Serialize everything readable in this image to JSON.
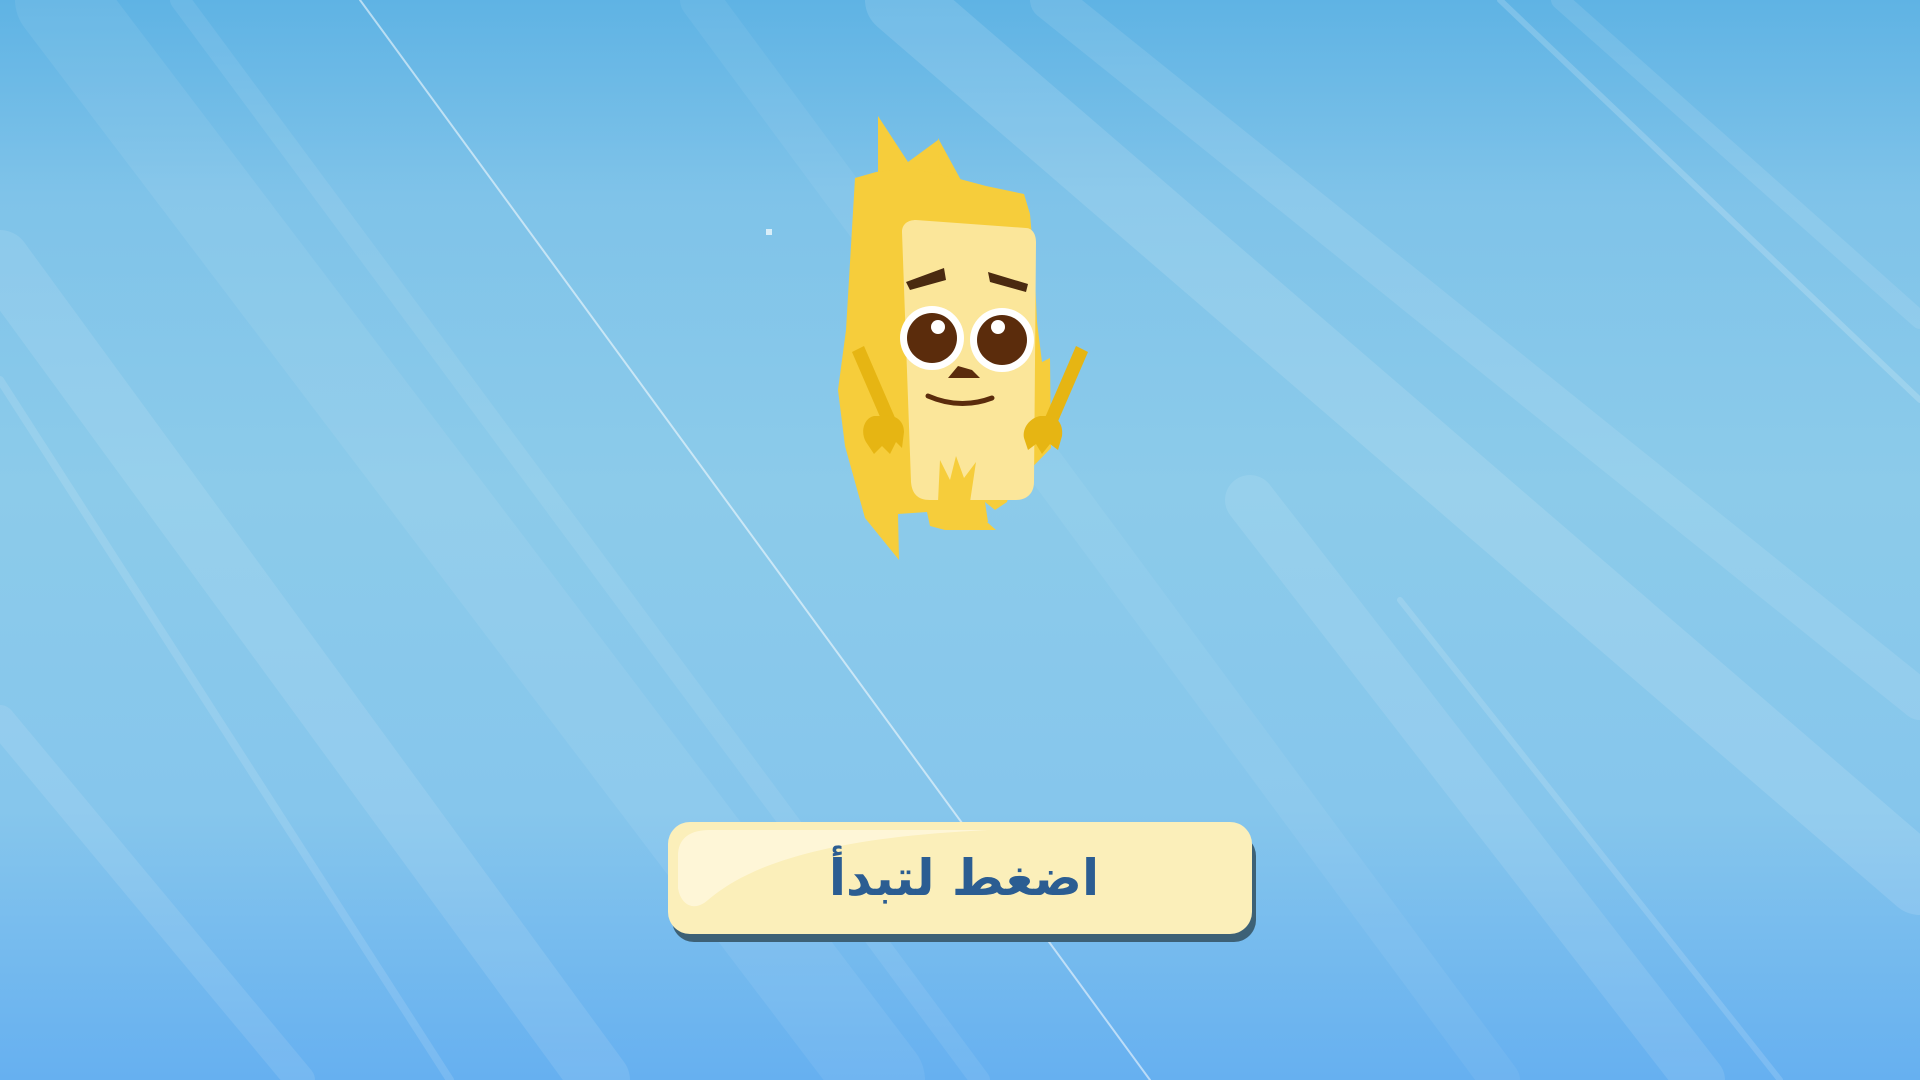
{
  "start_screen": {
    "start_button_label": "اضغط لتبدأ"
  },
  "colors": {
    "background_top": "#5fb3e4",
    "background_bottom": "#66b0f0",
    "mascot_body": "#f6cd3b",
    "mascot_face": "#fbe69a",
    "button_fill": "#fbefba",
    "button_text": "#2b5d92"
  },
  "icons": {
    "mascot": "yellow-monster-character"
  }
}
